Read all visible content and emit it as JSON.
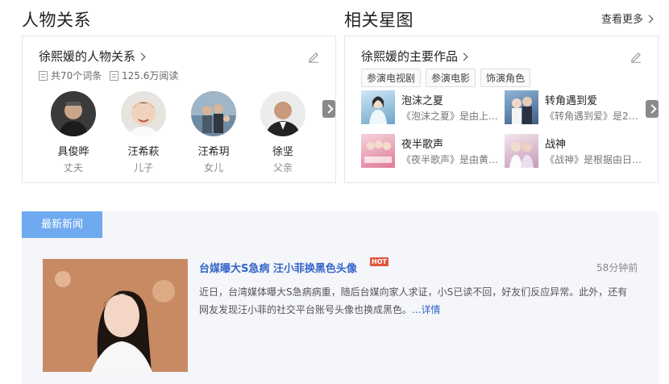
{
  "relations": {
    "section_title": "人物关系",
    "card_title": "徐熙媛的人物关系",
    "entries_count": "共70个词条",
    "reads": "125.6万阅读",
    "people": [
      {
        "name": "具俊晔",
        "relation": "丈夫"
      },
      {
        "name": "汪希萩",
        "relation": "儿子"
      },
      {
        "name": "汪希玥",
        "relation": "女儿"
      },
      {
        "name": "徐坚",
        "relation": "父亲"
      }
    ]
  },
  "stars": {
    "section_title": "相关星图",
    "more_label": "查看更多",
    "card_title": "徐熙媛的主要作品",
    "tags": [
      "参演电视剧",
      "参演电影",
      "饰演角色"
    ],
    "works": [
      {
        "title": "泡沫之夏",
        "desc": "《泡沫之夏》是由上…"
      },
      {
        "title": "转角遇到爱",
        "desc": "《转角遇到爱》是2…"
      },
      {
        "title": "夜半歌声",
        "desc": "《夜半歌声》是由黄…"
      },
      {
        "title": "战神",
        "desc": "《战神》是根据由日…"
      }
    ]
  },
  "news": {
    "tab_label": "最新新闻",
    "title": "台媒曝大S急病 汪小菲换黑色头像",
    "hot_badge": "HOT",
    "time": "58分钟前",
    "body": "近日，台湾媒体曝大S急病病重，随后台媒向家人求证，小S已读不回，好友们反应异常。此外，还有网友发现汪小菲的社交平台账号头像也换成黑色。",
    "more_label": "...详情"
  },
  "colors": {
    "link_blue": "#3565c8",
    "tab_blue": "#6faaf0",
    "hot_red": "#e0553a"
  }
}
